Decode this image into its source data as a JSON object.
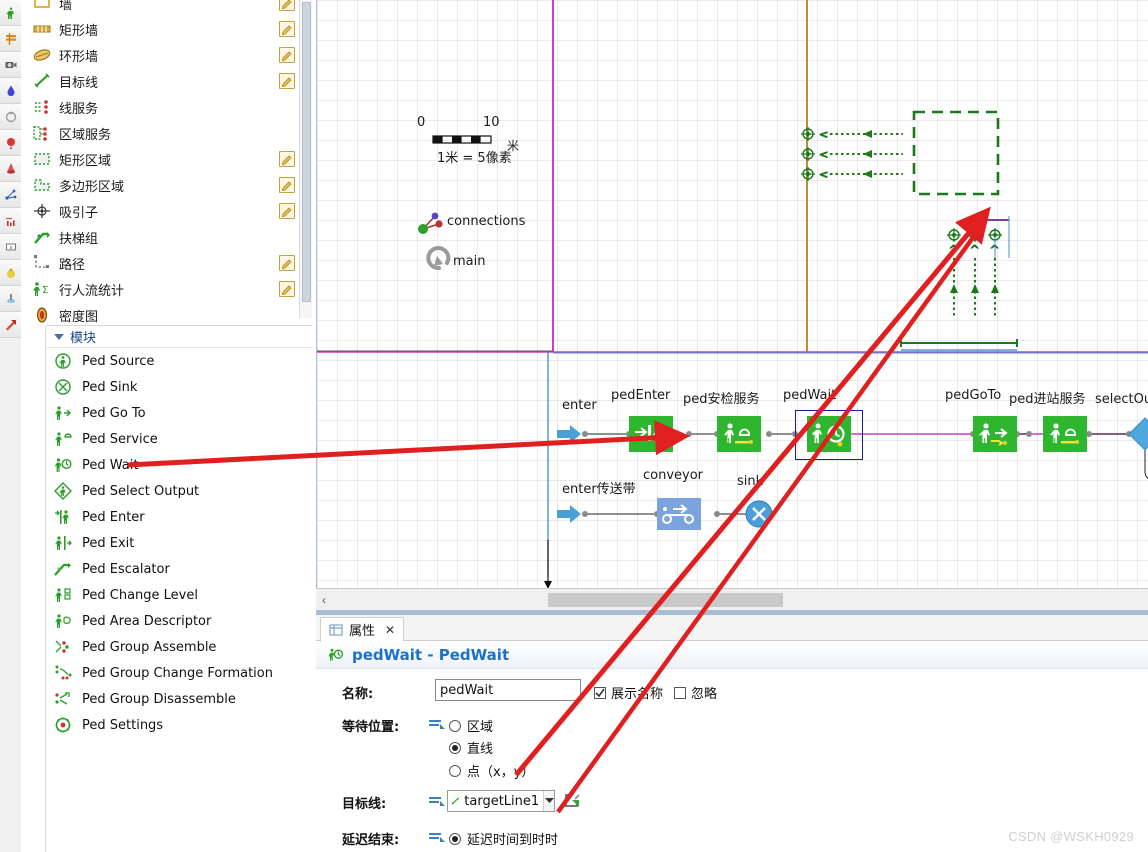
{
  "toolbar": {
    "name": "left-vertical-toolbar",
    "buttons": [
      {
        "name": "ped-tool",
        "icon": "person-green-icon"
      },
      {
        "name": "wall-tool",
        "icon": "wall-orange-icon"
      },
      {
        "name": "camera-tool",
        "icon": "camera-icon"
      },
      {
        "name": "attractor-tool",
        "icon": "blue-drop-icon"
      },
      {
        "name": "service-tool",
        "icon": "service-gray-icon"
      },
      {
        "name": "flow-tool",
        "icon": "red-balloon-icon"
      },
      {
        "name": "density-tool",
        "icon": "red-cone-icon"
      },
      {
        "name": "network-tool",
        "icon": "blue-node-icon"
      },
      {
        "name": "chart-tool",
        "icon": "red-bar-chart-icon"
      },
      {
        "name": "textbox-tool",
        "icon": "text-box-icon"
      },
      {
        "name": "yellow-object-tool",
        "icon": "yellow-sphere-icon"
      },
      {
        "name": "blue-object-tool",
        "icon": "blue-cylinder-icon"
      },
      {
        "name": "red-arrow-tool",
        "icon": "red-arrow-icon"
      },
      {
        "name": "green-pin-tool",
        "icon": "green-pin-icon"
      },
      {
        "name": "gray-object-tool",
        "icon": "gray-sphere-icon"
      }
    ]
  },
  "palette": {
    "name": "pedestrian-palette",
    "items": [
      {
        "label": "墙",
        "icon": "wall-icon",
        "edit": true,
        "partial": true
      },
      {
        "label": "矩形墙",
        "icon": "rect-wall-icon",
        "edit": true
      },
      {
        "label": "环形墙",
        "icon": "ring-wall-icon",
        "edit": true
      },
      {
        "label": "目标线",
        "icon": "target-line-icon",
        "edit": true
      },
      {
        "label": "线服务",
        "icon": "line-service-icon",
        "edit": false
      },
      {
        "label": "区域服务",
        "icon": "area-service-icon",
        "edit": false
      },
      {
        "label": "矩形区域",
        "icon": "rect-area-icon",
        "edit": true
      },
      {
        "label": "多边形区域",
        "icon": "polygon-area-icon",
        "edit": true
      },
      {
        "label": "吸引子",
        "icon": "attractor-icon",
        "edit": true
      },
      {
        "label": "扶梯组",
        "icon": "escalator-group-icon",
        "edit": false
      },
      {
        "label": "路径",
        "icon": "path-icon",
        "edit": true
      },
      {
        "label": "行人流统计",
        "icon": "ped-flow-statistics-icon",
        "edit": true
      },
      {
        "label": "密度图",
        "icon": "density-map-icon",
        "edit": false
      }
    ]
  },
  "modules": {
    "group_title": "模块",
    "items": [
      {
        "label": "Ped Source",
        "icon": "ped-source-icon"
      },
      {
        "label": "Ped Sink",
        "icon": "ped-sink-icon"
      },
      {
        "label": "Ped Go To",
        "icon": "ped-go-to-icon"
      },
      {
        "label": "Ped Service",
        "icon": "ped-service-icon"
      },
      {
        "label": "Ped Wait",
        "icon": "ped-wait-icon"
      },
      {
        "label": "Ped Select Output",
        "icon": "ped-select-output-icon"
      },
      {
        "label": "Ped Enter",
        "icon": "ped-enter-icon"
      },
      {
        "label": "Ped Exit",
        "icon": "ped-exit-icon"
      },
      {
        "label": "Ped Escalator",
        "icon": "ped-escalator-icon"
      },
      {
        "label": "Ped Change Level",
        "icon": "ped-change-level-icon"
      },
      {
        "label": "Ped Area Descriptor",
        "icon": "ped-area-descriptor-icon"
      },
      {
        "label": "Ped Group Assemble",
        "icon": "ped-group-assemble-icon"
      },
      {
        "label": "Ped Group Change Formation",
        "icon": "ped-group-change-formation-icon"
      },
      {
        "label": "Ped Group Disassemble",
        "icon": "ped-group-disassemble-icon"
      },
      {
        "label": "Ped Settings",
        "icon": "ped-settings-icon"
      }
    ]
  },
  "canvas": {
    "name": "model-canvas",
    "scale": {
      "tick_start": "0",
      "tick_end": "10",
      "unit": "米",
      "ratio_text": "1米 = 5像素"
    },
    "markers": [
      {
        "label": "connections",
        "icon": "connections-icon"
      },
      {
        "label": "main",
        "icon": "main-arrow-icon"
      }
    ],
    "flow_top": [
      {
        "label": "enter",
        "type": "source-arrow"
      },
      {
        "label": "pedEnter",
        "type": "ped-enter-block"
      },
      {
        "label": "ped安检服务",
        "type": "ped-service-block"
      },
      {
        "label": "pedWait",
        "type": "ped-wait-block",
        "selected": true
      },
      {
        "label": "pedGoTo",
        "type": "ped-go-to-block"
      },
      {
        "label": "ped进站服务",
        "type": "ped-service-block"
      },
      {
        "label": "selectOutp",
        "type": "select-output-diamond",
        "truncated": true
      }
    ],
    "flow_bottom": [
      {
        "label": "enter传送带",
        "type": "source-arrow"
      },
      {
        "label": "conveyor",
        "type": "conveyor-block"
      },
      {
        "label": "sink",
        "type": "sink-block"
      }
    ],
    "scrollbar": {
      "left_arrow": "‹"
    }
  },
  "properties": {
    "tab_label": "属性",
    "tab_close": "✕",
    "title": "pedWait - PedWait",
    "title_icon": "ped-wait-icon",
    "rows": {
      "name_label": "名称:",
      "name_value": "pedWait",
      "show_name_label": "展示名称",
      "show_name_checked": true,
      "ignore_label": "忽略",
      "ignore_checked": false,
      "wait_position_label": "等待位置:",
      "wait_position_options": [
        "区域",
        "直线",
        "点（x，y）"
      ],
      "wait_position_selected": 1,
      "target_line_label": "目标线:",
      "target_line_value": "targetLine1",
      "target_line_icon": "target-line-icon",
      "target_line_jump_icon": "jump-to-icon",
      "delay_end_label": "延迟结束:",
      "delay_end_option": "延迟时间到时时",
      "delay_end_selected": true
    }
  },
  "watermark": "CSDN @WSKH0929",
  "colors": {
    "green_block": "#2fb62f",
    "blue_block": "#7ba3dd",
    "diamond_blue": "#4fa8dd",
    "accent_link": "#1a73c8",
    "annotation_red": "#e02020",
    "selection_blue": "#1a1aa8",
    "magenta_line": "#c93fc9",
    "orange_line": "#c08a3e",
    "target_green": "#1a7a1a"
  }
}
